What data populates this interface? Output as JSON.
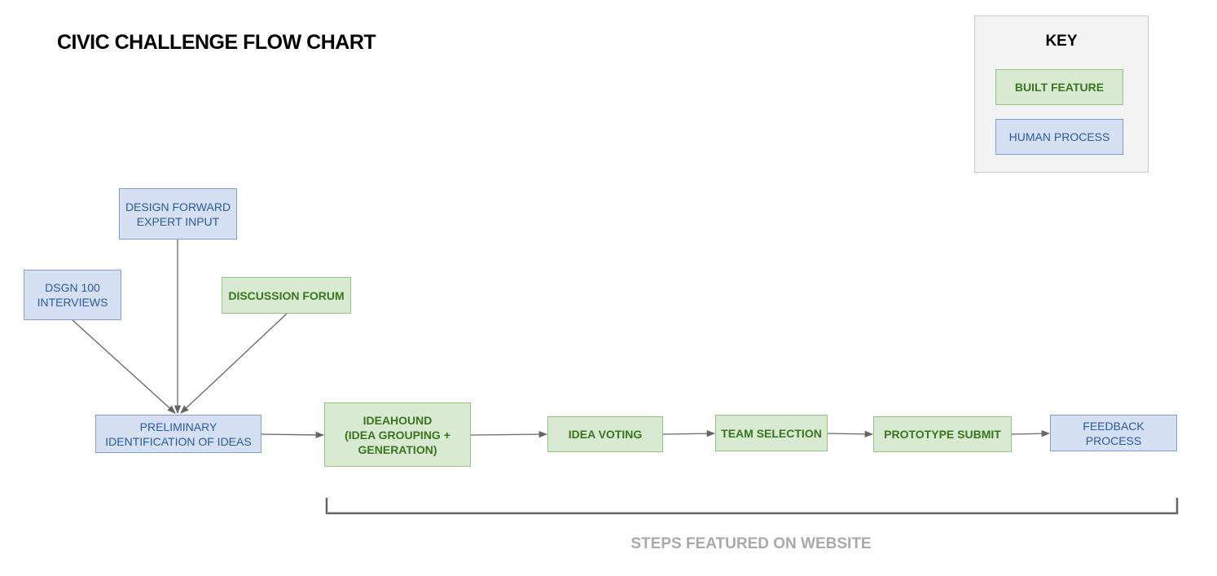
{
  "title": "CIVIC CHALLENGE FLOW CHART",
  "key": {
    "title": "KEY",
    "built_feature": "BUILT FEATURE",
    "human_process": "HUMAN PROCESS"
  },
  "colors": {
    "built_feature_fill": "#d9ead3",
    "built_feature_border": "#93c47d",
    "built_feature_text": "#38761d",
    "human_process_fill": "#d5e0f3",
    "human_process_border": "#7f9fd8",
    "human_process_text": "#2a5aa0",
    "arrow": "#666666"
  },
  "nodes": {
    "design_forward": "DESIGN FORWARD\nEXPERT INPUT",
    "dsgn_100": "DSGN 100\nINTERVIEWS",
    "discussion_forum": "DISCUSSION FORUM",
    "preliminary": "PRELIMINARY\nIDENTIFICATION OF IDEAS",
    "ideahound": "IDEAHOUND\n(IDEA GROUPING +\nGENERATION)",
    "idea_voting": "IDEA VOTING",
    "team_selection": "TEAM SELECTION",
    "prototype_submit": "PROTOTYPE SUBMIT",
    "feedback_process": "FEEDBACK PROCESS"
  },
  "bracket_label": "STEPS FEATURED ON WEBSITE"
}
